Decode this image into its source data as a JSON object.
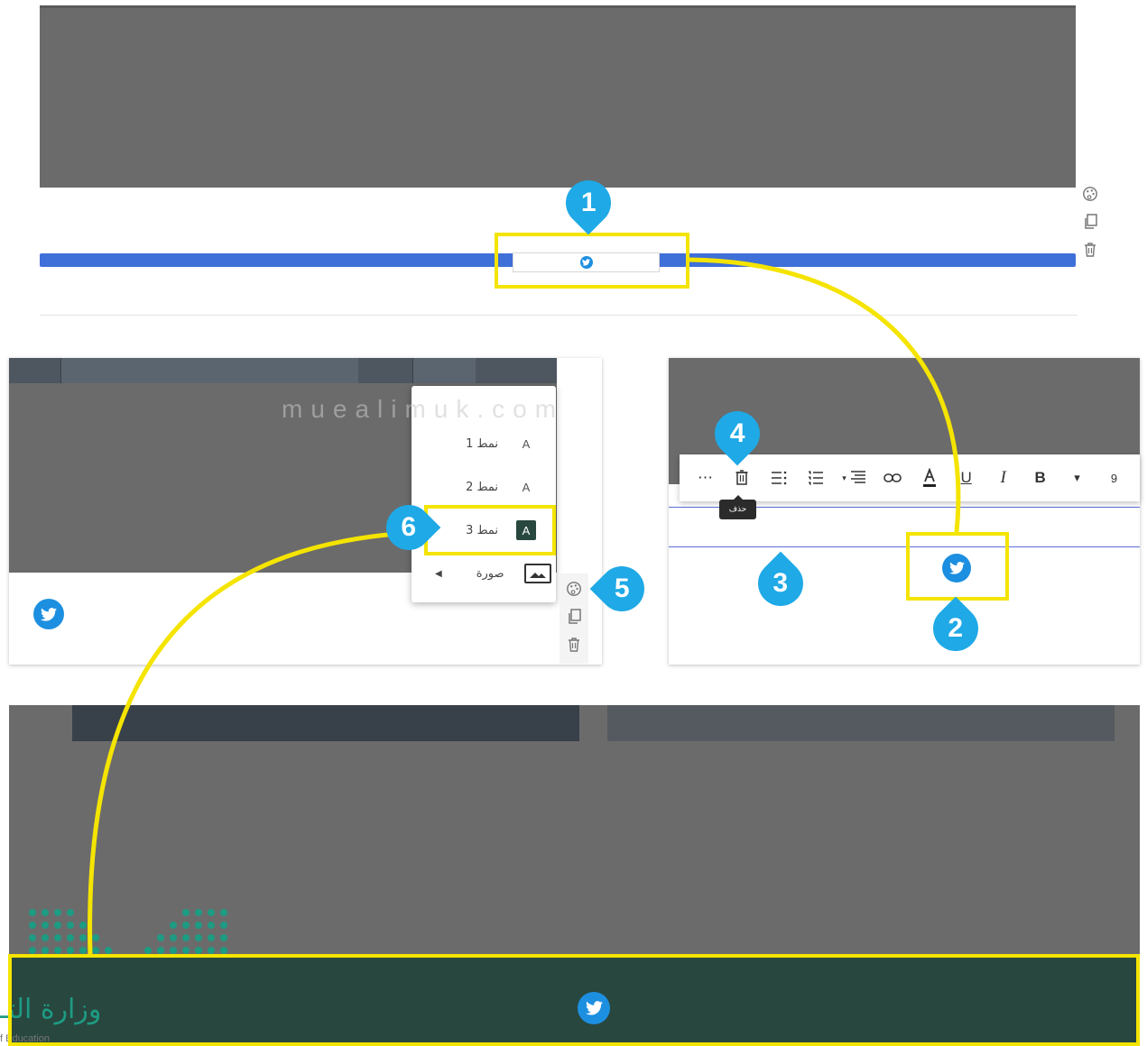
{
  "colors": {
    "accent_blue": "#3f6fd8",
    "twitter_blue": "#1d8fe0",
    "highlight_yellow": "#f4e400",
    "marker_blue": "#1fa9e6",
    "footer_green": "#28473f",
    "placeholder_gray": "#6b6b6b"
  },
  "top_panel": {
    "social_icon": "twitter-icon",
    "tools": [
      "palette-icon",
      "duplicate-icon",
      "trash-icon"
    ]
  },
  "style_menu": {
    "items": [
      {
        "label": "نمط 1",
        "swatch": "A"
      },
      {
        "label": "نمط 2",
        "swatch": "A"
      },
      {
        "label": "نمط 3",
        "swatch": "A"
      },
      {
        "label": "صورة",
        "swatch": "image-icon"
      }
    ],
    "tools": [
      "palette-icon",
      "duplicate-icon",
      "trash-icon"
    ]
  },
  "editor_toolbar": {
    "buttons": [
      "⋯",
      "trash-icon",
      "align-right-list-icon",
      "numbered-list-icon",
      "align-dropdown-icon",
      "link-icon",
      "text-color-icon",
      "U",
      "I",
      "B",
      "▾",
      "9"
    ],
    "tooltip": "حذف"
  },
  "markers": [
    "1",
    "2",
    "3",
    "4",
    "5",
    "6"
  ],
  "watermark": {
    "text": "muealimuk.com"
  },
  "logo": {
    "text": "وزارة التـ",
    "sub": "f Education"
  }
}
